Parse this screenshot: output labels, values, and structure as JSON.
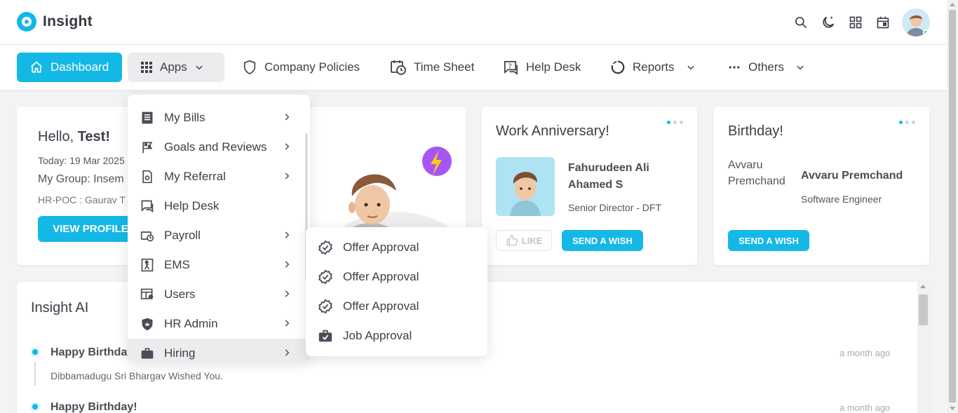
{
  "app": {
    "name": "Insight"
  },
  "nav": {
    "dashboard": "Dashboard",
    "apps": "Apps",
    "company_policies": "Company Policies",
    "time_sheet": "Time Sheet",
    "help_desk": "Help Desk",
    "reports": "Reports",
    "others": "Others"
  },
  "hello": {
    "greeting": "Hello, ",
    "name": "Test!",
    "today": "Today: 19 Mar 2025",
    "group": "My Group: Insem",
    "hr_poc": "HR-POC : Gaurav T",
    "view_profile": "VIEW PROFILE"
  },
  "anniversary": {
    "title": "Work Anniversary!",
    "name": "Fahurudeen Ali Ahamed S",
    "role": "Senior Director - DFT",
    "like": "LIKE",
    "send_wish": "SEND A WISH"
  },
  "birthday": {
    "title": "Birthday!",
    "img_alt": "Avvaru Premchand",
    "name": "Avvaru Premchand",
    "role": "Software Engineer",
    "send_wish": "SEND A WISH"
  },
  "insight_ai": {
    "title": "Insight AI",
    "items": [
      {
        "title": "Happy Birthday!",
        "sub": "Dibbamadugu Sri Bhargav Wished You.",
        "time": "a month ago"
      },
      {
        "title": "Happy Birthday!",
        "sub": "",
        "time": "a month ago"
      }
    ]
  },
  "apps_menu": [
    {
      "label": "My Bills",
      "icon": "bills-icon",
      "has_sub": true
    },
    {
      "label": "Goals and Reviews",
      "icon": "flag-icon",
      "has_sub": true
    },
    {
      "label": "My Referral",
      "icon": "referral-icon",
      "has_sub": true
    },
    {
      "label": "Help Desk",
      "icon": "helpdesk-icon",
      "has_sub": false
    },
    {
      "label": "Payroll",
      "icon": "payroll-icon",
      "has_sub": true
    },
    {
      "label": "EMS",
      "icon": "ems-icon",
      "has_sub": true
    },
    {
      "label": "Users",
      "icon": "users-icon",
      "has_sub": true
    },
    {
      "label": "HR Admin",
      "icon": "shield-icon",
      "has_sub": true
    },
    {
      "label": "Hiring",
      "icon": "briefcase-icon",
      "has_sub": true
    }
  ],
  "hiring_submenu": [
    {
      "label": "Offer Approval",
      "icon": "verified-badge-icon"
    },
    {
      "label": "Offer Approval",
      "icon": "verified-badge-icon"
    },
    {
      "label": "Offer Approval",
      "icon": "verified-badge-icon"
    },
    {
      "label": "Job Approval",
      "icon": "briefcase-check-icon"
    }
  ],
  "colors": {
    "accent": "#14b8e6",
    "text": "#3d4049",
    "active_bg": "#ececee"
  }
}
